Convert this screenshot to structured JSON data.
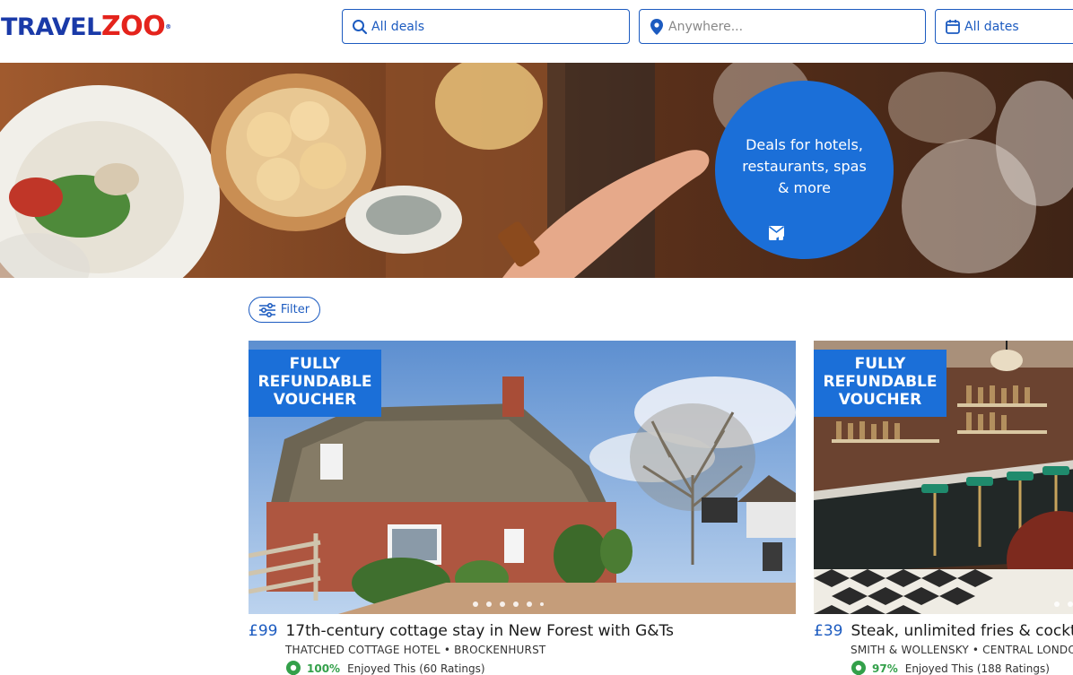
{
  "header": {
    "logo_part1": "TRAVEL",
    "logo_part2": "ZOO",
    "logo_mark": "®",
    "search_deals": "All deals",
    "search_location_placeholder": "Anywhere...",
    "search_dates": "All dates"
  },
  "hero": {
    "tagline": "Deals for hotels, restaurants, spas & more",
    "share_icons": [
      "facebook-icon",
      "twitter-icon",
      "email-icon"
    ]
  },
  "filter": {
    "label": "Filter"
  },
  "cards": [
    {
      "badge_line1": "FULLY",
      "badge_line2": "REFUNDABLE",
      "badge_line3": "VOUCHER",
      "price": "£99",
      "title": "17th-century cottage stay in New Forest with G&Ts",
      "subtitle": "THATCHED COTTAGE HOTEL • BROCKENHURST",
      "rating_pct": "100%",
      "rating_text": "Enjoyed This (60 Ratings)"
    },
    {
      "badge_line1": "FULLY",
      "badge_line2": "REFUNDABLE",
      "badge_line3": "VOUCHER",
      "price": "£39",
      "title": "Steak, unlimited fries & cocktail",
      "subtitle": "SMITH & WOLLENSKY • CENTRAL LONDON",
      "rating_pct": "97%",
      "rating_text": "Enjoyed This (188 Ratings)"
    }
  ],
  "colors": {
    "brand_blue": "#1c5bc0",
    "hero_blue": "#1b6fd8",
    "rating_green": "#33a04a",
    "logo_red": "#e4231c"
  }
}
